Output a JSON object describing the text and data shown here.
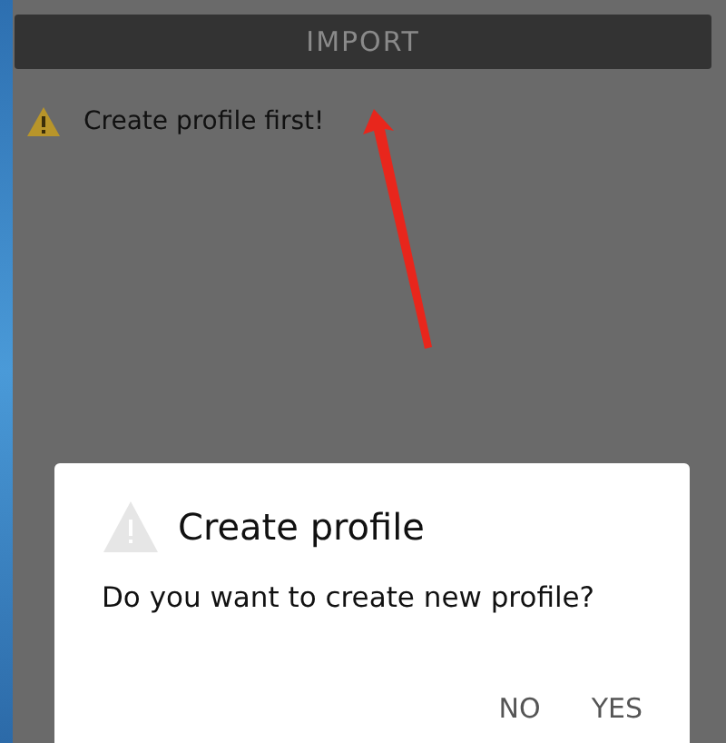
{
  "import_button": {
    "label": "IMPORT",
    "disabled": true
  },
  "warning": {
    "text": "Create profile first!"
  },
  "dialog": {
    "title": "Create profile",
    "message": "Do you want to create new profile?",
    "buttons": [
      {
        "label": "NO"
      },
      {
        "label": "YES"
      }
    ]
  }
}
